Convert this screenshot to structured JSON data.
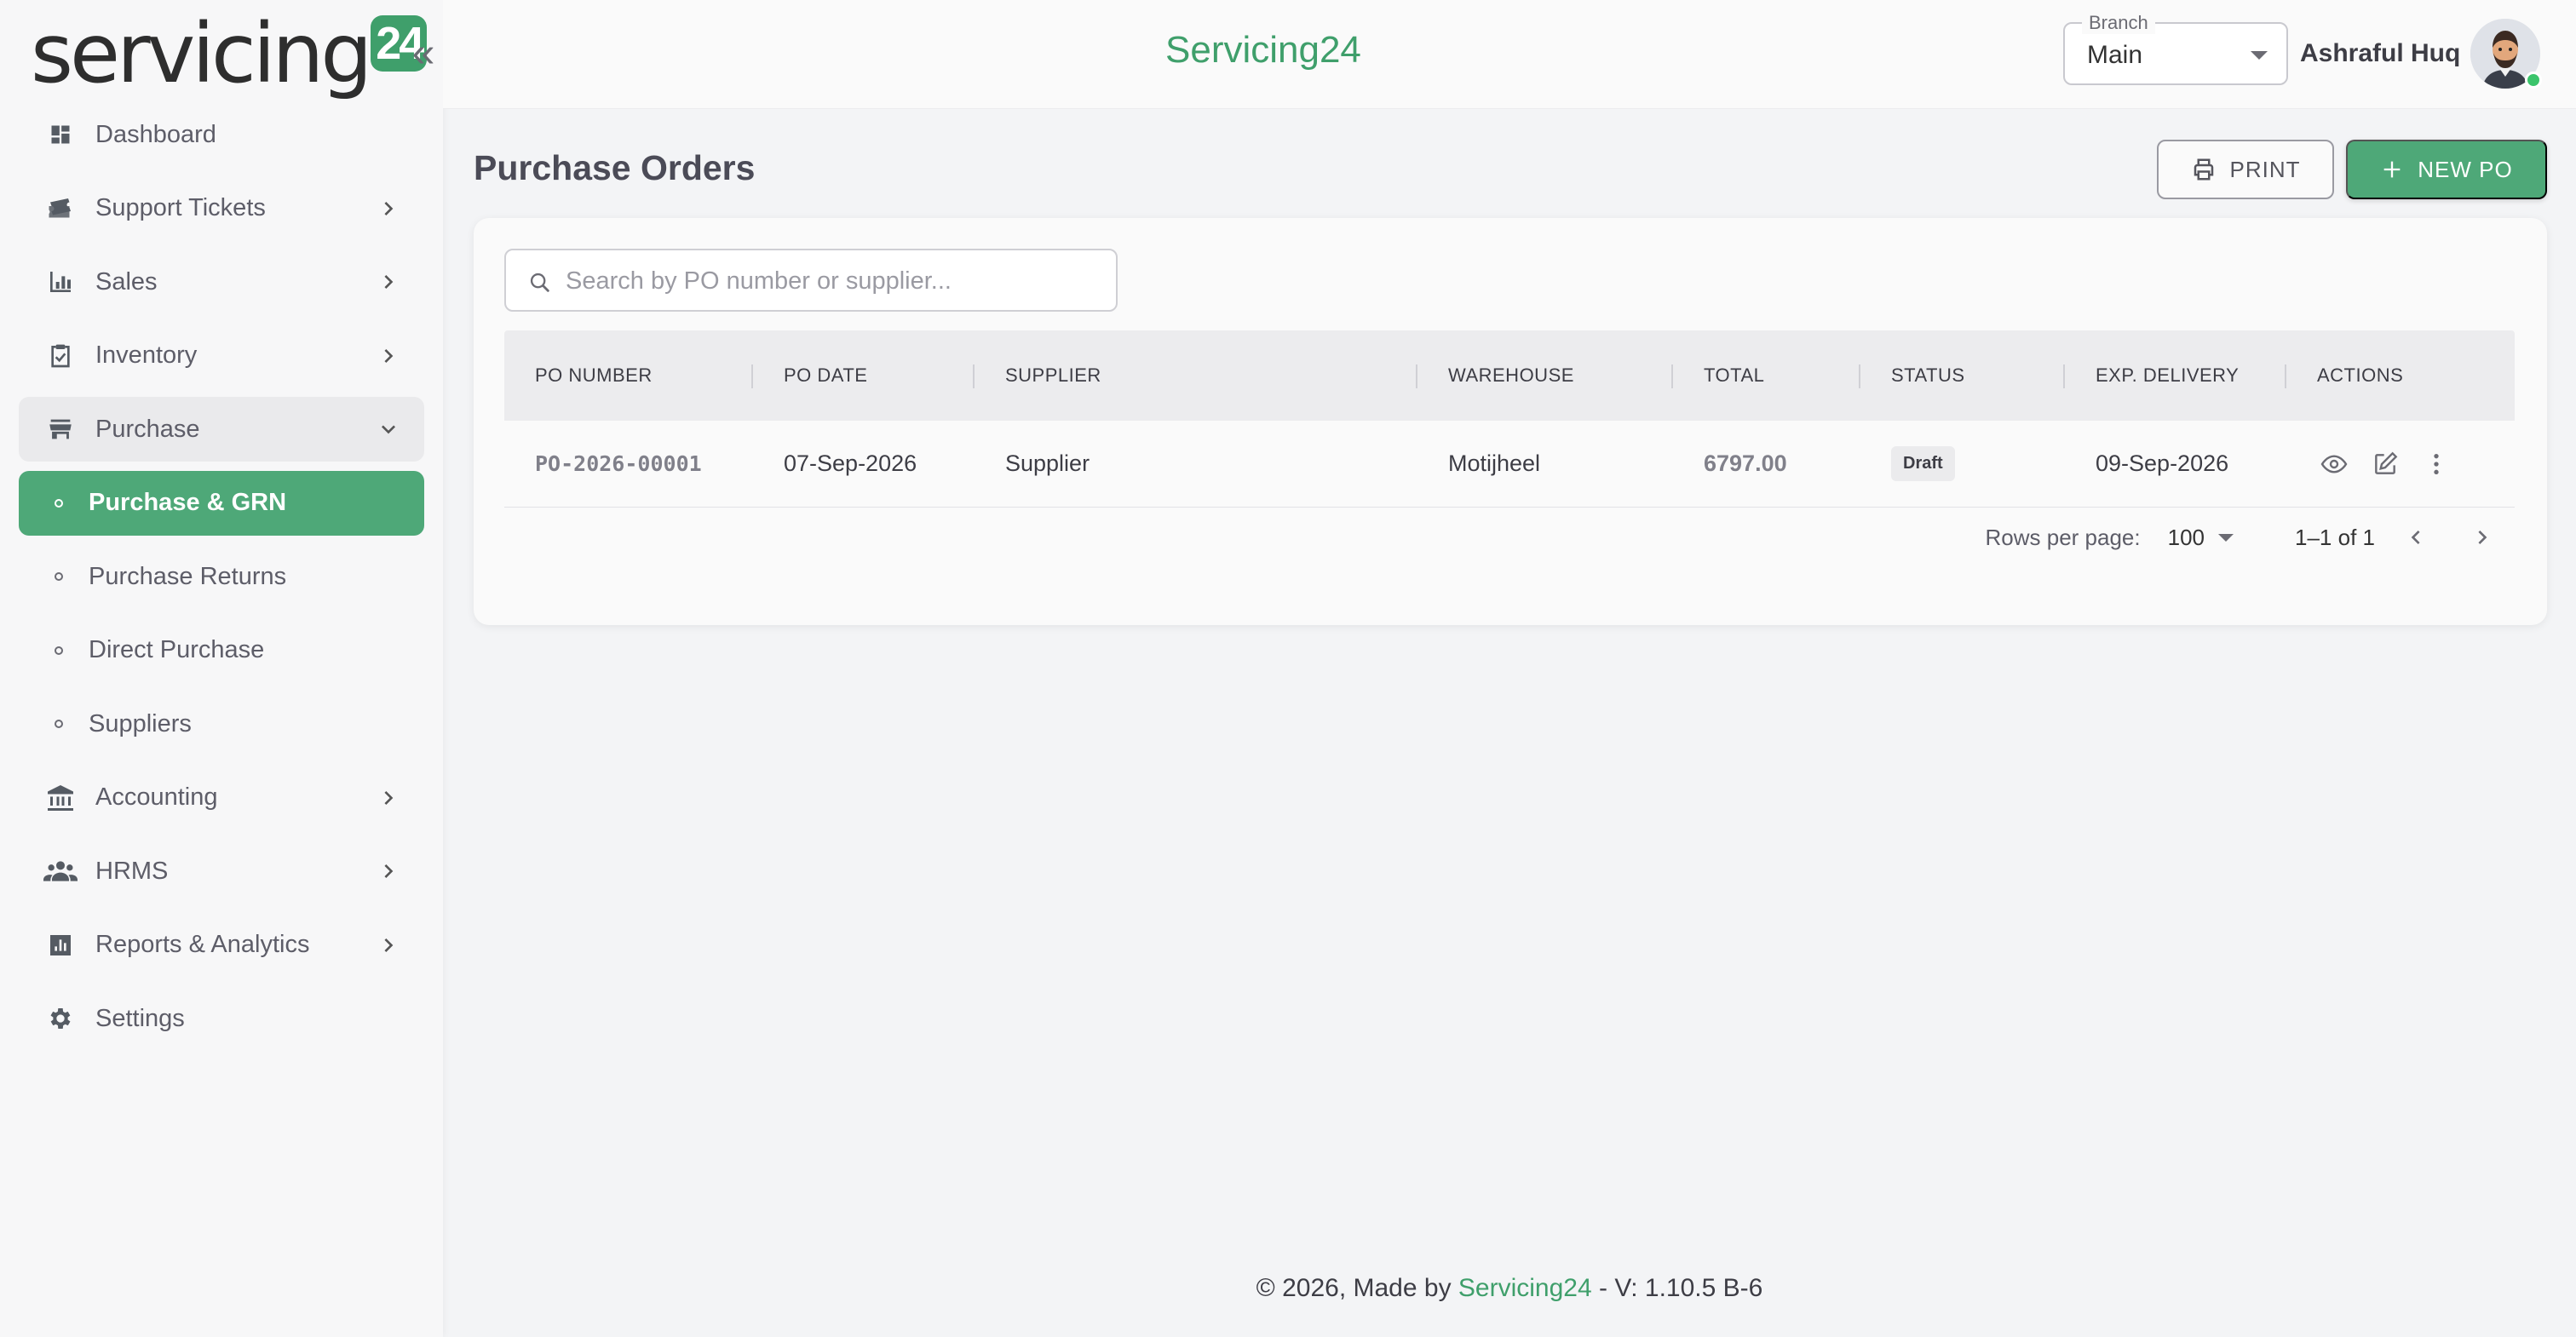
{
  "brand": {
    "logo_text": "servicing",
    "logo_badge": "24",
    "collapse_glyph": "«",
    "accent_color": "#4ea878"
  },
  "header": {
    "title": "Servicing24",
    "branch": {
      "label": "Branch",
      "value": "Main"
    },
    "user_name": "Ashraful Huq"
  },
  "sidebar": {
    "items": [
      {
        "label": "Dashboard",
        "icon": "dashboard-icon"
      },
      {
        "label": "Support Tickets",
        "icon": "ticket-icon"
      },
      {
        "label": "Sales",
        "icon": "bar-chart-icon"
      },
      {
        "label": "Inventory",
        "icon": "clipboard-check-icon"
      },
      {
        "label": "Purchase",
        "icon": "store-icon",
        "expanded": true,
        "children": [
          {
            "label": "Purchase & GRN",
            "active": true
          },
          {
            "label": "Purchase Returns"
          },
          {
            "label": "Direct Purchase"
          },
          {
            "label": "Suppliers"
          }
        ]
      },
      {
        "label": "Accounting",
        "icon": "bank-icon"
      },
      {
        "label": "HRMS",
        "icon": "people-icon"
      },
      {
        "label": "Reports & Analytics",
        "icon": "analytics-icon"
      },
      {
        "label": "Settings",
        "icon": "gear-icon"
      }
    ]
  },
  "main": {
    "title": "Purchase Orders",
    "print_label": "PRINT",
    "new_label": "NEW PO",
    "search": {
      "placeholder": "Search by PO number or supplier...",
      "value": ""
    },
    "table": {
      "columns": [
        "PO NUMBER",
        "PO DATE",
        "SUPPLIER",
        "WAREHOUSE",
        "TOTAL",
        "STATUS",
        "EXP. DELIVERY",
        "ACTIONS"
      ],
      "rows": [
        {
          "po_number": "PO-2026-00001",
          "po_date": "07-Sep-2026",
          "supplier": "Supplier",
          "warehouse": "Motijheel",
          "total": "6797.00",
          "status": "Draft",
          "exp_delivery": "09-Sep-2026"
        }
      ]
    },
    "pagination": {
      "rows_per_page_label": "Rows per page:",
      "rows_per_page": "100",
      "range": "1–1 of 1"
    }
  },
  "footer": {
    "prefix": "© 2026, Made by ",
    "brand": "Servicing24",
    "suffix": " - V: 1.10.5 B-6"
  }
}
